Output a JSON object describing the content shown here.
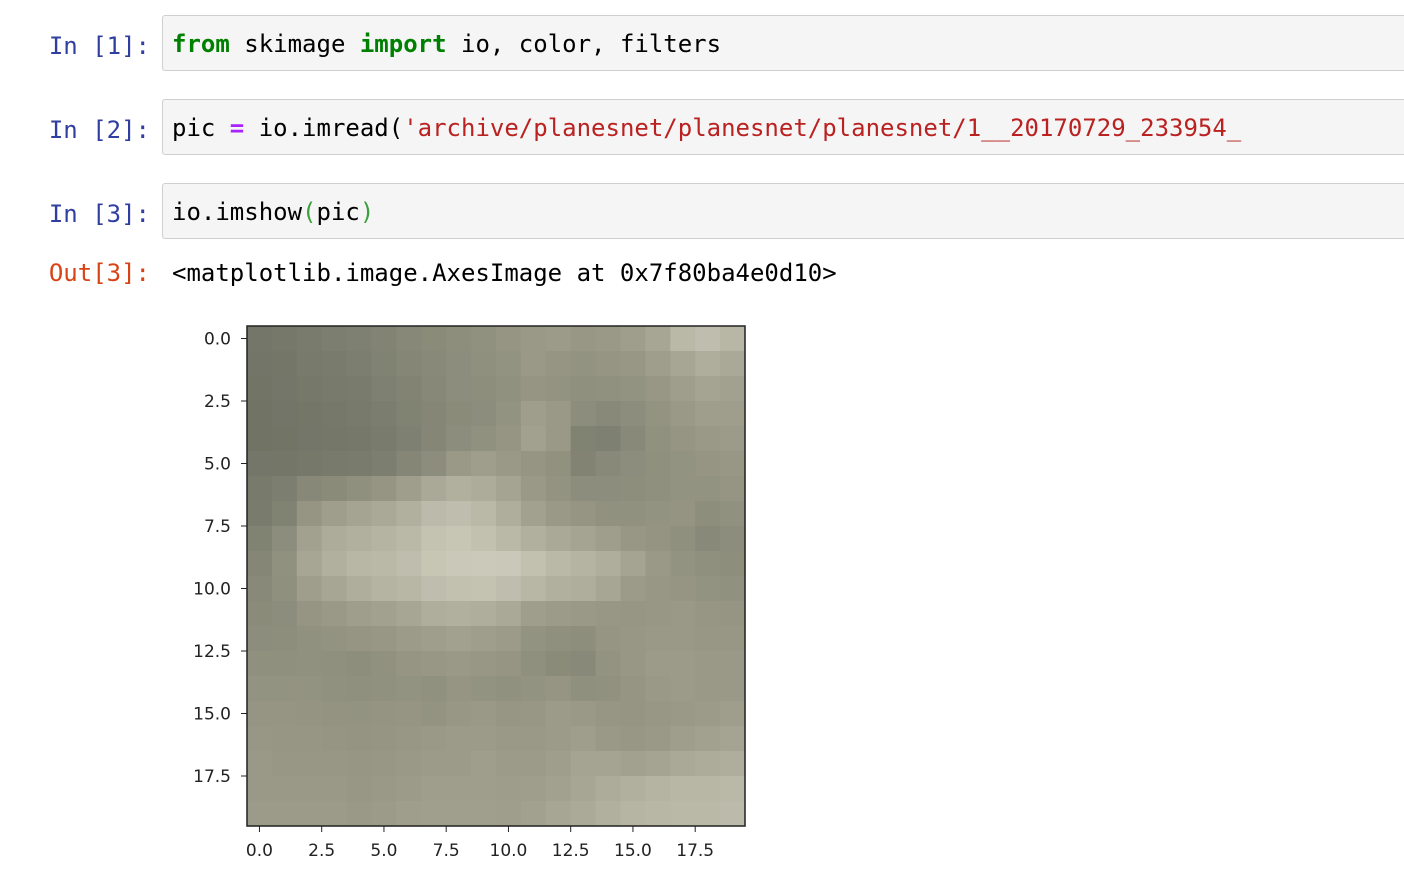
{
  "cells": [
    {
      "prompt": "In [1]:",
      "tokens": [
        {
          "text": "from",
          "style": "kw"
        },
        {
          "text": " skimage ",
          "style": "plain"
        },
        {
          "text": "import",
          "style": "kw"
        },
        {
          "text": " io, color, filters",
          "style": "plain"
        }
      ]
    },
    {
      "prompt": "In [2]:",
      "tokens": [
        {
          "text": "pic ",
          "style": "plain"
        },
        {
          "text": "=",
          "style": "op"
        },
        {
          "text": " io.imread(",
          "style": "plain"
        },
        {
          "text": "'archive/planesnet/planesnet/planesnet/1__20170729_233954_",
          "style": "str"
        }
      ]
    },
    {
      "prompt": "In [3]:",
      "tokens": [
        {
          "text": "io.imshow",
          "style": "plain"
        },
        {
          "text": "(",
          "style": "paren"
        },
        {
          "text": "pic",
          "style": "plain"
        },
        {
          "text": ")",
          "style": "paren"
        }
      ]
    }
  ],
  "output": {
    "prompt": "Out[3]:",
    "text": "<matplotlib.image.AxesImage at 0x7f80ba4e0d10>"
  },
  "chart_data": {
    "type": "heatmap",
    "description_of_content": "20x20 RGB image displayed with imshow",
    "x_ticks": [
      "0.0",
      "2.5",
      "5.0",
      "7.5",
      "10.0",
      "12.5",
      "15.0",
      "17.5"
    ],
    "y_ticks": [
      "0.0",
      "2.5",
      "5.0",
      "7.5",
      "10.0",
      "12.5",
      "15.0",
      "17.5"
    ],
    "xlim": [
      -0.5,
      19.5
    ],
    "ylim": [
      19.5,
      -0.5
    ],
    "palette": {
      "dark": "#6f7264",
      "mid": "#9a9987",
      "light": "#cfcdbd"
    },
    "grid": [
      [
        0.05,
        0.08,
        0.12,
        0.15,
        0.18,
        0.22,
        0.28,
        0.32,
        0.36,
        0.4,
        0.45,
        0.5,
        0.52,
        0.48,
        0.5,
        0.55,
        0.62,
        0.8,
        0.85,
        0.78
      ],
      [
        0.04,
        0.06,
        0.1,
        0.12,
        0.15,
        0.2,
        0.25,
        0.3,
        0.35,
        0.38,
        0.42,
        0.5,
        0.45,
        0.42,
        0.45,
        0.48,
        0.55,
        0.62,
        0.7,
        0.65
      ],
      [
        0.03,
        0.05,
        0.08,
        0.1,
        0.12,
        0.18,
        0.22,
        0.28,
        0.34,
        0.36,
        0.4,
        0.45,
        0.42,
        0.38,
        0.4,
        0.42,
        0.48,
        0.55,
        0.6,
        0.58
      ],
      [
        0.02,
        0.04,
        0.06,
        0.08,
        0.1,
        0.14,
        0.2,
        0.26,
        0.32,
        0.34,
        0.42,
        0.55,
        0.5,
        0.35,
        0.3,
        0.35,
        0.42,
        0.5,
        0.55,
        0.55
      ],
      [
        0.02,
        0.03,
        0.05,
        0.07,
        0.08,
        0.12,
        0.18,
        0.25,
        0.35,
        0.4,
        0.45,
        0.58,
        0.5,
        0.2,
        0.18,
        0.3,
        0.4,
        0.45,
        0.5,
        0.52
      ],
      [
        0.05,
        0.06,
        0.08,
        0.1,
        0.12,
        0.15,
        0.25,
        0.35,
        0.5,
        0.55,
        0.5,
        0.45,
        0.4,
        0.22,
        0.3,
        0.35,
        0.38,
        0.42,
        0.45,
        0.48
      ],
      [
        0.1,
        0.15,
        0.28,
        0.32,
        0.38,
        0.45,
        0.55,
        0.65,
        0.72,
        0.68,
        0.6,
        0.5,
        0.42,
        0.35,
        0.35,
        0.36,
        0.38,
        0.42,
        0.42,
        0.45
      ],
      [
        0.12,
        0.2,
        0.45,
        0.55,
        0.6,
        0.65,
        0.72,
        0.82,
        0.85,
        0.8,
        0.7,
        0.58,
        0.5,
        0.45,
        0.4,
        0.4,
        0.42,
        0.44,
        0.36,
        0.4
      ],
      [
        0.2,
        0.35,
        0.58,
        0.68,
        0.72,
        0.75,
        0.8,
        0.9,
        0.92,
        0.88,
        0.8,
        0.72,
        0.65,
        0.6,
        0.55,
        0.48,
        0.44,
        0.38,
        0.3,
        0.35
      ],
      [
        0.25,
        0.4,
        0.62,
        0.72,
        0.78,
        0.8,
        0.85,
        0.92,
        0.95,
        0.96,
        0.95,
        0.88,
        0.8,
        0.75,
        0.7,
        0.6,
        0.5,
        0.42,
        0.38,
        0.36
      ],
      [
        0.3,
        0.38,
        0.55,
        0.62,
        0.7,
        0.75,
        0.78,
        0.85,
        0.88,
        0.9,
        0.85,
        0.78,
        0.72,
        0.7,
        0.62,
        0.52,
        0.48,
        0.45,
        0.42,
        0.4
      ],
      [
        0.32,
        0.35,
        0.45,
        0.5,
        0.55,
        0.58,
        0.62,
        0.7,
        0.72,
        0.7,
        0.65,
        0.55,
        0.52,
        0.5,
        0.48,
        0.46,
        0.48,
        0.5,
        0.46,
        0.45
      ],
      [
        0.35,
        0.36,
        0.4,
        0.42,
        0.45,
        0.48,
        0.52,
        0.55,
        0.58,
        0.55,
        0.52,
        0.42,
        0.38,
        0.36,
        0.45,
        0.48,
        0.5,
        0.5,
        0.48,
        0.48
      ],
      [
        0.38,
        0.38,
        0.4,
        0.38,
        0.36,
        0.4,
        0.45,
        0.48,
        0.5,
        0.48,
        0.45,
        0.38,
        0.32,
        0.3,
        0.42,
        0.48,
        0.52,
        0.52,
        0.5,
        0.5
      ],
      [
        0.42,
        0.42,
        0.42,
        0.4,
        0.38,
        0.4,
        0.42,
        0.4,
        0.45,
        0.42,
        0.4,
        0.42,
        0.45,
        0.38,
        0.4,
        0.45,
        0.5,
        0.52,
        0.5,
        0.5
      ],
      [
        0.45,
        0.45,
        0.44,
        0.42,
        0.42,
        0.44,
        0.45,
        0.42,
        0.48,
        0.5,
        0.46,
        0.48,
        0.52,
        0.5,
        0.46,
        0.45,
        0.48,
        0.5,
        0.52,
        0.55
      ],
      [
        0.48,
        0.46,
        0.46,
        0.45,
        0.44,
        0.45,
        0.48,
        0.5,
        0.52,
        0.52,
        0.5,
        0.5,
        0.52,
        0.55,
        0.5,
        0.48,
        0.5,
        0.55,
        0.58,
        0.6
      ],
      [
        0.5,
        0.48,
        0.48,
        0.48,
        0.46,
        0.48,
        0.5,
        0.52,
        0.52,
        0.55,
        0.52,
        0.52,
        0.55,
        0.6,
        0.6,
        0.58,
        0.6,
        0.65,
        0.68,
        0.7
      ],
      [
        0.5,
        0.5,
        0.5,
        0.5,
        0.48,
        0.5,
        0.52,
        0.55,
        0.55,
        0.55,
        0.54,
        0.55,
        0.58,
        0.62,
        0.68,
        0.72,
        0.75,
        0.78,
        0.78,
        0.8
      ],
      [
        0.52,
        0.52,
        0.52,
        0.52,
        0.5,
        0.52,
        0.55,
        0.56,
        0.56,
        0.56,
        0.55,
        0.58,
        0.62,
        0.66,
        0.72,
        0.76,
        0.78,
        0.8,
        0.8,
        0.82
      ]
    ]
  }
}
